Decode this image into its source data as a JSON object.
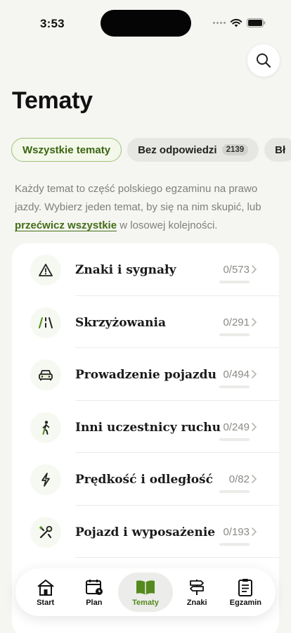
{
  "status": {
    "time": "3:53"
  },
  "header": {
    "title": "Tematy"
  },
  "filters": [
    {
      "label": "Wszystkie tematy",
      "count": ""
    },
    {
      "label": "Bez odpowiedzi",
      "count": "2139"
    },
    {
      "label": "Bł",
      "count": ""
    }
  ],
  "intro": {
    "text_before": "Każdy temat to część polskiego egzaminu na prawo jazdy. Wybierz jeden temat, by się na nim skupić, lub ",
    "link": "przećwicz wszystkie",
    "text_after": " w losowej kolejności."
  },
  "topics": [
    {
      "title": "Znaki i sygnały",
      "count": "0/573",
      "progress": 0,
      "icon": "warning-triangle-icon"
    },
    {
      "title": "Skrzyżowania",
      "count": "0/291",
      "progress": 0,
      "icon": "road-icon"
    },
    {
      "title": "Prowadzenie pojazdu",
      "count": "0/494",
      "progress": 0,
      "icon": "car-icon"
    },
    {
      "title": "Inni uczestnicy ruchu",
      "count": "0/249",
      "progress": 0,
      "icon": "pedestrian-icon"
    },
    {
      "title": "Prędkość i odległość",
      "count": "0/82",
      "progress": 0,
      "icon": "lightning-icon"
    },
    {
      "title": "Pojazd i wyposażenie",
      "count": "0/193",
      "progress": 0,
      "icon": "tools-icon"
    }
  ],
  "tabs": [
    {
      "label": "Start",
      "icon": "house-icon"
    },
    {
      "label": "Plan",
      "icon": "calendar-icon"
    },
    {
      "label": "Tematy",
      "icon": "book-icon"
    },
    {
      "label": "Znaki",
      "icon": "signpost-icon"
    },
    {
      "label": "Egzamin",
      "icon": "clipboard-icon"
    }
  ],
  "colors": {
    "accent": "#55891d",
    "link": "#426e14",
    "background": "#f5f5f2"
  }
}
